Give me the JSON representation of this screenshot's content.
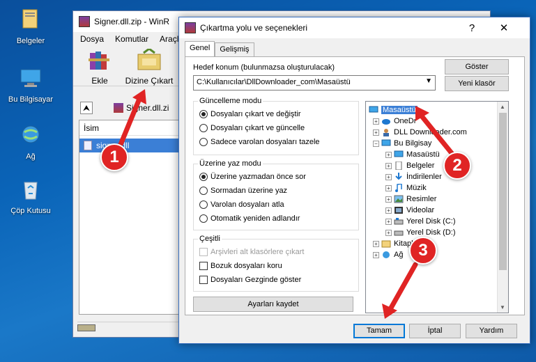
{
  "desktop": {
    "icons": [
      {
        "label": "Belgeler",
        "icon": "documents-folder-icon"
      },
      {
        "label": "Bu Bilgisayar",
        "icon": "computer-icon"
      },
      {
        "label": "Ağ",
        "icon": "network-icon"
      },
      {
        "label": "Çöp Kutusu",
        "icon": "recycle-bin-icon"
      }
    ]
  },
  "winrar": {
    "title": "Signer.dll.zip - WinR",
    "menu": [
      "Dosya",
      "Komutlar",
      "Araçla"
    ],
    "toolbar": {
      "add_label": "Ekle",
      "extract_label": "Dizine Çıkart"
    },
    "path": "Signer.dll.zi",
    "column_name": "İsim",
    "file": "signer.dll"
  },
  "dialog": {
    "title": "Çıkartma yolu ve seçenekleri",
    "help_btn": "?",
    "close_btn": "✕",
    "tabs": [
      "Genel",
      "Gelişmiş"
    ],
    "target_label": "Hedef konum (bulunmazsa oluşturulacak)",
    "target_value": "C:\\Kullanıcılar\\DllDownloader_com\\Masaüstü",
    "show_btn": "Göster",
    "new_folder_btn": "Yeni klasör",
    "update_mode": {
      "title": "Güncelleme modu",
      "options": [
        "Dosyaları çıkart ve değiştir",
        "Dosyaları çıkart ve güncelle",
        "Sadece varolan dosyaları tazele"
      ],
      "selected": 0
    },
    "overwrite_mode": {
      "title": "Üzerine yaz modu",
      "options": [
        "Üzerine yazmadan önce sor",
        "Sormadan üzerine yaz",
        "Varolan dosyaları atla",
        "Otomatik yeniden adlandır"
      ],
      "selected": 0
    },
    "misc": {
      "title": "Çeşitli",
      "options": [
        "Arşivleri alt klasörlere çıkart",
        "Bozuk dosyaları koru",
        "Dosyaları Gezginde göster"
      ]
    },
    "save_settings_btn": "Ayarları kaydet",
    "tree": [
      "Masaüstü",
      "OneDr",
      "DLL Downloader.com",
      "Bu Bilgisay",
      "Masaüstü",
      "Belgeler",
      "İndirilenler",
      "Müzik",
      "Resimler",
      "Videolar",
      "Yerel Disk (C:)",
      "Yerel Disk (D:)",
      "Kitapl",
      "Ağ"
    ],
    "ok_btn": "Tamam",
    "cancel_btn": "İptal",
    "help_text_btn": "Yardım"
  },
  "callouts": [
    "1",
    "2",
    "3"
  ]
}
